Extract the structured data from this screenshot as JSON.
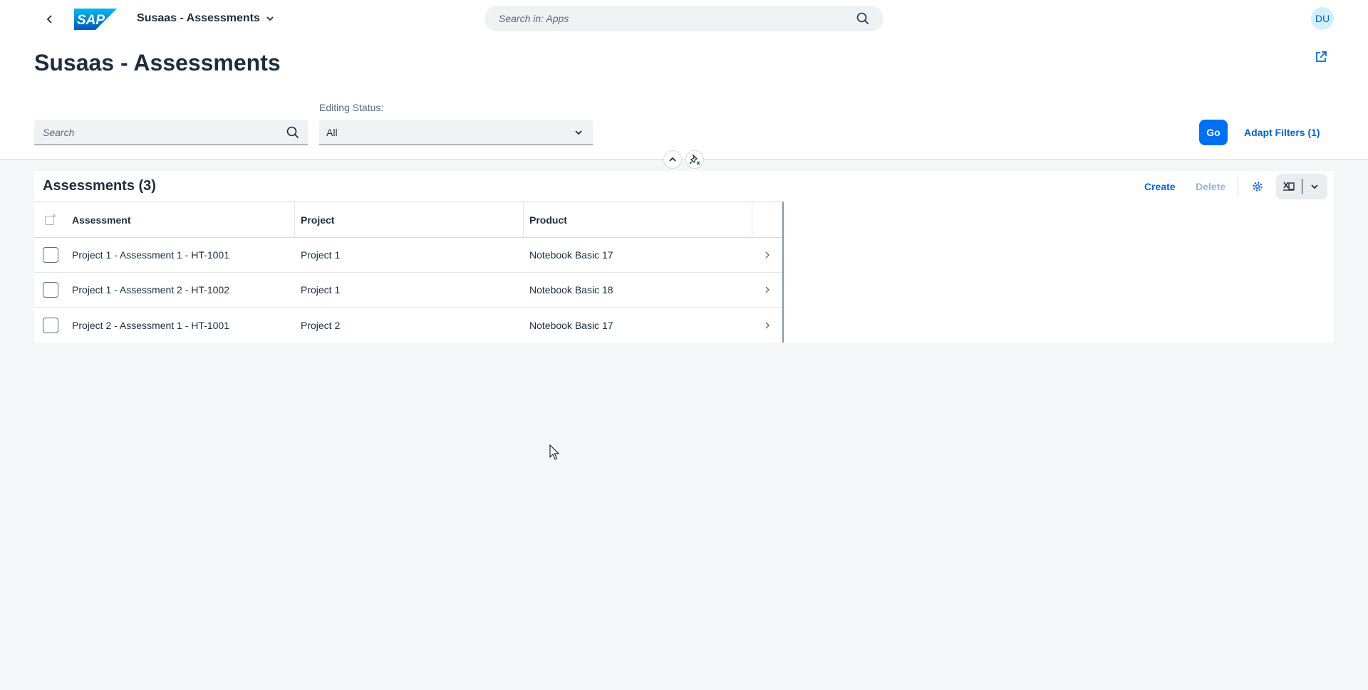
{
  "shell": {
    "app_title": "Susaas - Assessments",
    "search_placeholder": "Search in: Apps",
    "avatar_initials": "DU",
    "logo_text": "SAP"
  },
  "header": {
    "page_title": "Susaas - Assessments"
  },
  "filters": {
    "search_placeholder": "Search",
    "editing_status_label": "Editing Status:",
    "editing_status_value": "All",
    "go_label": "Go",
    "adapt_filters_label": "Adapt Filters (1)"
  },
  "table": {
    "title": "Assessments (3)",
    "create_label": "Create",
    "delete_label": "Delete",
    "columns": [
      "Assessment",
      "Project",
      "Product"
    ],
    "rows": [
      {
        "assessment": "Project 1 - Assessment 1 - HT-1001",
        "project": "Project 1",
        "product": "Notebook Basic 17"
      },
      {
        "assessment": "Project 1 - Assessment 2 - HT-1002",
        "project": "Project 1",
        "product": "Notebook Basic 18"
      },
      {
        "assessment": "Project 2 - Assessment 1 - HT-1001",
        "project": "Project 2",
        "product": "Notebook Basic 17"
      }
    ]
  },
  "colors": {
    "brand": "#0070f2",
    "link": "#0064d9",
    "disabled_link": "#8fb4e5",
    "text": "#1d2d3e",
    "background": "#f5f6f7"
  },
  "icons": [
    "back-icon",
    "chevron-down-icon",
    "search-icon",
    "share-icon",
    "collapse-icon",
    "pin-icon",
    "settings-icon",
    "excel-export-icon",
    "navigation-arrow-icon"
  ]
}
